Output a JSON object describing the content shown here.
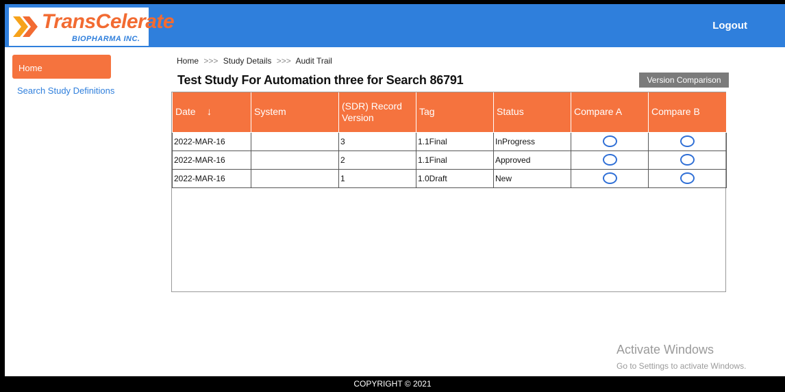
{
  "header": {
    "logo_text": "TransCelerate",
    "logo_subtext": "BIOPHARMA INC.",
    "logout_label": "Logout"
  },
  "sidebar": {
    "home_label": "Home",
    "search_label": "Search Study Definitions"
  },
  "breadcrumb": {
    "items": [
      "Home",
      "Study Details",
      "Audit Trail"
    ],
    "separator": ">>>"
  },
  "page_title": "Test Study For Automation three for Search 86791",
  "version_comparison_label": "Version Comparison",
  "table": {
    "columns": [
      "Date",
      "System",
      "(SDR) Record Version",
      "Tag",
      "Status",
      "Compare A",
      "Compare B"
    ],
    "rows": [
      {
        "date": "2022-MAR-16",
        "system": "",
        "version": "3",
        "tag": "1.1Final",
        "status": "InProgress"
      },
      {
        "date": "2022-MAR-16",
        "system": "",
        "version": "2",
        "tag": "1.1Final",
        "status": "Approved"
      },
      {
        "date": "2022-MAR-16",
        "system": "",
        "version": "1",
        "tag": "1.0Draft",
        "status": "New"
      }
    ]
  },
  "watermark": {
    "title": "Activate Windows",
    "subtitle": "Go to Settings to activate Windows."
  },
  "footer": "COPYRIGHT © 2021",
  "colors": {
    "header_blue": "#2f7fdc",
    "accent_orange": "#f5733e",
    "button_gray": "#7b7b7b"
  },
  "icons": {
    "sort": "arrow-down-icon",
    "logo": "chevron-logo-icon"
  }
}
